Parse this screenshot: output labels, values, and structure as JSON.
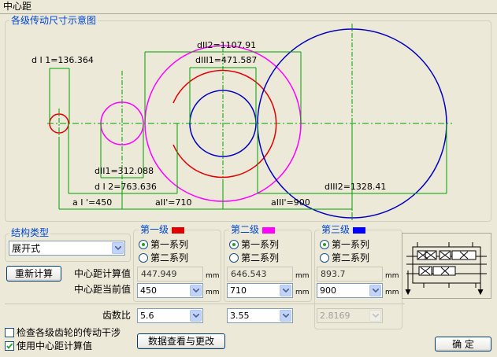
{
  "window": {
    "title": "中心距"
  },
  "diagram": {
    "group_label": "各级传动尺寸示意图",
    "labels": {
      "d_i1": "d I 1=136.364",
      "d_ii2": "dII2=1107.91",
      "d_iii1": "dIII1=471.587",
      "d_ii1": "dII1=312.088",
      "d_i2": "d I 2=763.636",
      "a_i": "a I '=450",
      "a_ii": "aII'=710",
      "a_iii": "aIII'=900",
      "d_iii2": "dIII2=1328.41"
    },
    "colors": {
      "stage1": "#e00000",
      "stage2": "#ff00ff",
      "stage3": "#0000c0",
      "dim": "#00a000"
    }
  },
  "structure": {
    "group_label": "结构类型",
    "value": "展开式"
  },
  "recalc_label": "重新计算",
  "rows": {
    "calc_label": "中心距计算值",
    "current_label": "中心距当前值",
    "ratio_label": "齿数比"
  },
  "unit": "mm",
  "stages": [
    {
      "title": "第一级",
      "color": "#e00000",
      "series1": "第一系列",
      "series2": "第二系列",
      "calc": "447.949",
      "current": "450",
      "ratio": "5.6"
    },
    {
      "title": "第二级",
      "color": "#ff00ff",
      "series1": "第一系列",
      "series2": "第二系列",
      "calc": "646.543",
      "current": "710",
      "ratio": "3.55"
    },
    {
      "title": "第三级",
      "color": "#0000ff",
      "series1": "第一系列",
      "series2": "第二系列",
      "calc": "893.7",
      "current": "900",
      "ratio": "2.8169"
    }
  ],
  "options": {
    "interference": "检查各级齿轮的传动干涉",
    "use_calc": "使用中心距计算值"
  },
  "data_button": "数据查看与更改",
  "ok_button": "确  定"
}
